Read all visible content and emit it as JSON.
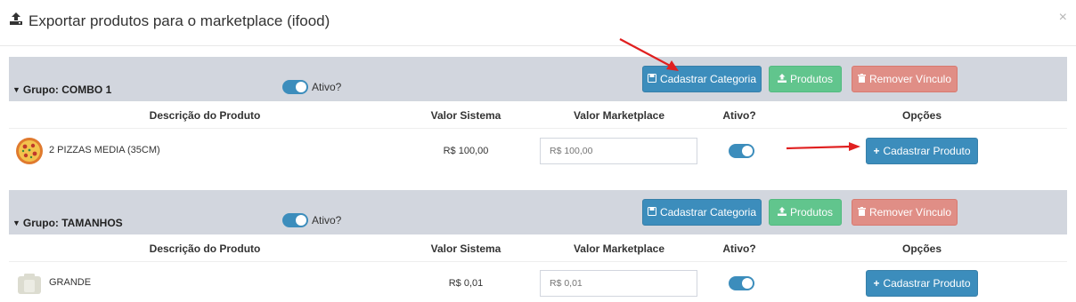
{
  "modal": {
    "title": "Exportar produtos para o marketplace (ifood)",
    "close_label": "×"
  },
  "columns": {
    "descricao": "Descrição do Produto",
    "valor_sistema": "Valor Sistema",
    "valor_marketplace": "Valor Marketplace",
    "ativo": "Ativo?",
    "opcoes": "Opções"
  },
  "buttons": {
    "cadastrar_categoria": "Cadastrar Categoria",
    "produtos": "Produtos",
    "remover_vinculo": "Remover Vínculo",
    "cadastrar_produto": "Cadastrar Produto"
  },
  "groups": [
    {
      "name": "Grupo: COMBO 1",
      "ativo_label": "Ativo?",
      "ativo": true,
      "products": [
        {
          "name": "2 PIZZAS MEDIA (35CM)",
          "valor_sistema": "R$ 100,00",
          "valor_marketplace": "R$ 100,00",
          "ativo": true,
          "image": "pizza-icon"
        }
      ]
    },
    {
      "name": "Grupo: TAMANHOS",
      "ativo_label": "Ativo?",
      "ativo": true,
      "products": [
        {
          "name": "GRANDE",
          "valor_sistema": "R$ 0,01",
          "valor_marketplace": "R$ 0,01",
          "ativo": true,
          "image": "camera-placeholder-icon"
        }
      ]
    }
  ],
  "colors": {
    "primary": "#3c8dbc",
    "success": "#5cc589",
    "danger": "#e08e86",
    "group_bar": "#d2d6de",
    "annotation_arrow": "#e02020"
  }
}
